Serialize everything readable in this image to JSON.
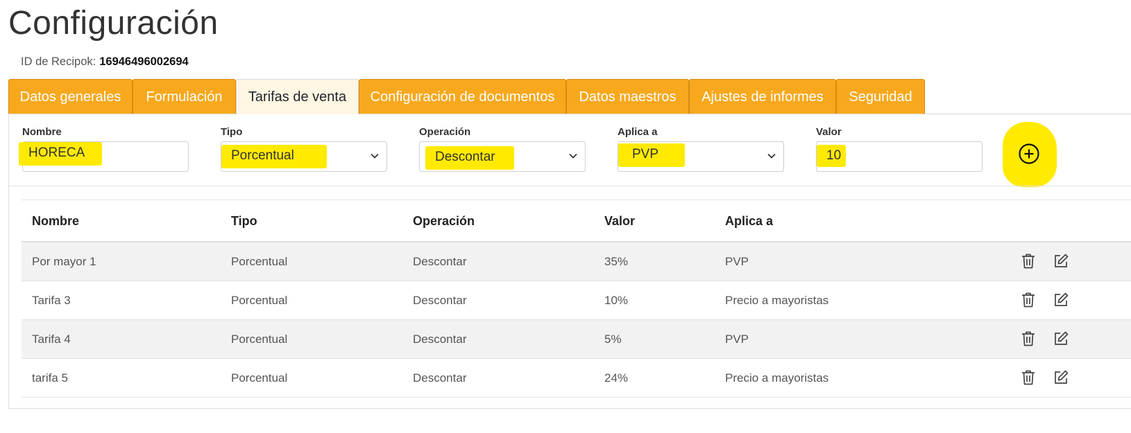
{
  "page": {
    "title": "Configuración"
  },
  "recipok": {
    "label": "ID de Recipok:",
    "value": "16946496002694"
  },
  "tabs": [
    {
      "label": "Datos generales"
    },
    {
      "label": "Formulación"
    },
    {
      "label": "Tarifas de venta",
      "active": true
    },
    {
      "label": "Configuración de documentos"
    },
    {
      "label": "Datos maestros"
    },
    {
      "label": "Ajustes de informes"
    },
    {
      "label": "Seguridad"
    }
  ],
  "form": {
    "nombre": {
      "label": "Nombre",
      "value": "HORECA"
    },
    "tipo": {
      "label": "Tipo",
      "value": "Porcentual"
    },
    "operacion": {
      "label": "Operación",
      "value": "Descontar"
    },
    "aplica": {
      "label": "Aplica a",
      "value": "PVP"
    },
    "valor": {
      "label": "Valor",
      "value": "10"
    },
    "add_icon": "plus-circle-icon"
  },
  "highlight_color": "#ffea00",
  "tab_color": "#f8a81d",
  "table": {
    "headers": [
      "Nombre",
      "Tipo",
      "Operación",
      "Valor",
      "Aplica a"
    ],
    "rows": [
      [
        "Por mayor 1",
        "Porcentual",
        "Descontar",
        "35%",
        "PVP"
      ],
      [
        "Tarifa 3",
        "Porcentual",
        "Descontar",
        "10%",
        "Precio a mayoristas"
      ],
      [
        "Tarifa 4",
        "Porcentual",
        "Descontar",
        "5%",
        "PVP"
      ],
      [
        "tarifa 5",
        "Porcentual",
        "Descontar",
        "24%",
        "Precio a mayoristas"
      ]
    ],
    "row_actions": [
      "trash-icon",
      "edit-icon"
    ]
  }
}
